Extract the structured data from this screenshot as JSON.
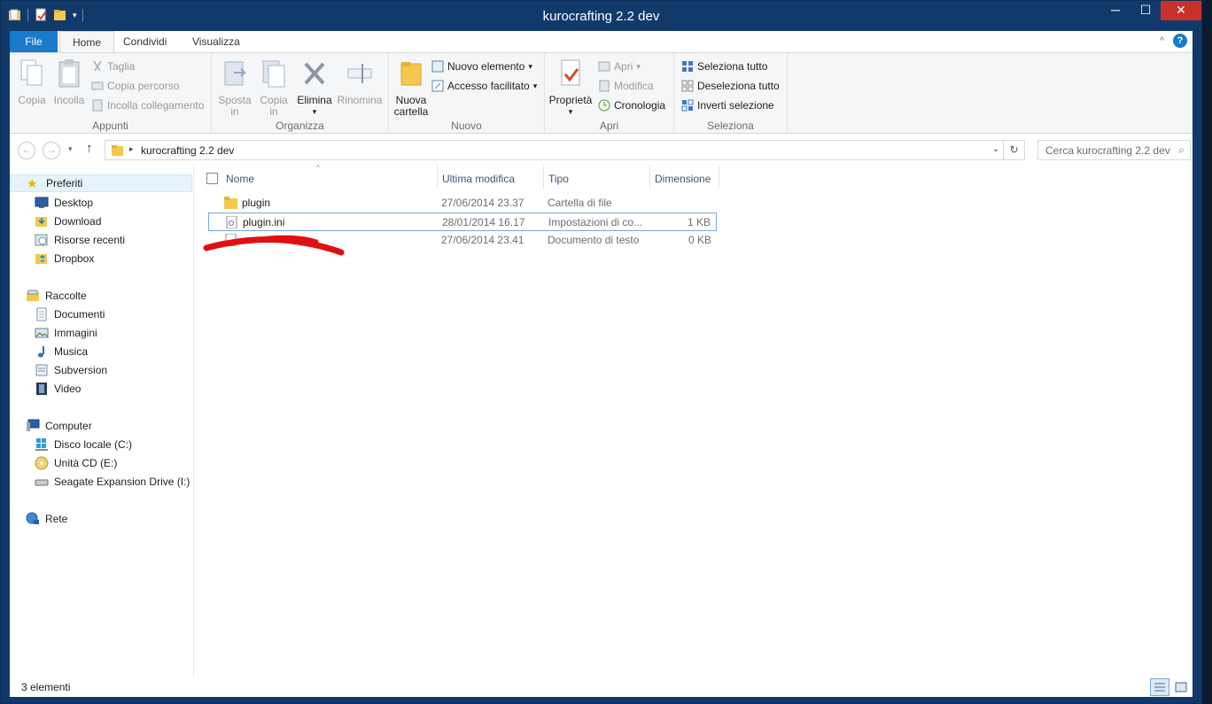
{
  "window": {
    "title": "kurocrafting 2.2 dev",
    "controls": {
      "minimize": "─",
      "maximize": "☐",
      "close": "✕"
    }
  },
  "ribbon_tabs": {
    "file": "File",
    "home": "Home",
    "share": "Condividi",
    "view": "Visualizza"
  },
  "ribbon": {
    "appunti": {
      "name": "Appunti",
      "copy": "Copia",
      "paste": "Incolla",
      "cut": "Taglia",
      "copy_path": "Copia percorso",
      "paste_link": "Incolla collegamento"
    },
    "organizza": {
      "name": "Organizza",
      "move_to": "Sposta",
      "copy_to": "Copia",
      "in": "in",
      "delete": "Elimina",
      "rename": "Rinomina"
    },
    "nuovo": {
      "name": "Nuovo",
      "new_folder_1": "Nuova",
      "new_folder_2": "cartella",
      "new_item": "Nuovo elemento",
      "easy_access": "Accesso facilitato"
    },
    "apri": {
      "name": "Apri",
      "properties": "Proprietà",
      "open": "Apri",
      "edit": "Modifica",
      "history": "Cronologia"
    },
    "seleziona": {
      "name": "Seleziona",
      "select_all": "Seleziona tutto",
      "select_none": "Deseleziona tutto",
      "invert": "Inverti selezione"
    }
  },
  "address": {
    "path": "kurocrafting 2.2 dev",
    "search_placeholder": "Cerca kurocrafting 2.2 dev"
  },
  "sidebar": {
    "favorites": "Preferiti",
    "fav_items": [
      "Desktop",
      "Download",
      "Risorse recenti",
      "Dropbox"
    ],
    "libraries": "Raccolte",
    "lib_items": [
      "Documenti",
      "Immagini",
      "Musica",
      "Subversion",
      "Video"
    ],
    "computer": "Computer",
    "comp_items": [
      "Disco locale (C:)",
      "Unità CD (E:)",
      "Seagate Expansion Drive (I:)"
    ],
    "network": "Rete"
  },
  "columns": {
    "name": "Nome",
    "modified": "Ultima modifica",
    "type": "Tipo",
    "size": "Dimensione"
  },
  "files": [
    {
      "name": "plugin",
      "modified": "27/06/2014 23.37",
      "type": "Cartella di file",
      "size": ""
    },
    {
      "name": "plugin.ini",
      "modified": "28/01/2014 16.17",
      "type": "Impostazioni di co...",
      "size": "1 KB"
    },
    {
      "name": "",
      "modified": "27/06/2014 23.41",
      "type": "Documento di testo",
      "size": "0 KB"
    }
  ],
  "status": {
    "count": "3 elementi"
  },
  "colors": {
    "titlebar": "#113a6b",
    "file_tab": "#1979ca",
    "close": "#c7302b",
    "folder": "#f2c94c",
    "redaction": "#e01010"
  }
}
